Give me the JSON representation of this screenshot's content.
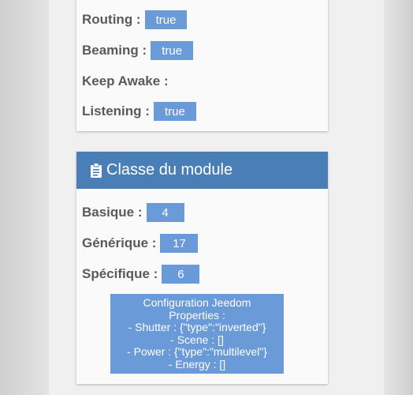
{
  "device_info": {
    "rows": [
      {
        "label": "Routing :",
        "value": "true"
      },
      {
        "label": "Beaming :",
        "value": "true"
      },
      {
        "label": "Keep Awake :",
        "value": ""
      },
      {
        "label": "Listening :",
        "value": "true"
      }
    ]
  },
  "module_class": {
    "title": "Classe du module",
    "icon": "clipboard-icon",
    "rows": [
      {
        "label": "Basique :",
        "value": "4"
      },
      {
        "label": "Générique :",
        "value": "17"
      },
      {
        "label": "Spécifique :",
        "value": "6"
      }
    ]
  },
  "config": {
    "lines": [
      "Configuration Jeedom",
      "Properties :",
      "- Shutter : {\"type\":\"inverted\"}",
      "- Scene : []",
      "- Power : {\"type\":\"multilevel\"}",
      "- Energy : []"
    ]
  },
  "colors": {
    "header_bg": "#4a7eb7",
    "badge_bg": "#6b9ad8",
    "label_text": "#5a5a5a",
    "card_bg": "#fafafa"
  }
}
